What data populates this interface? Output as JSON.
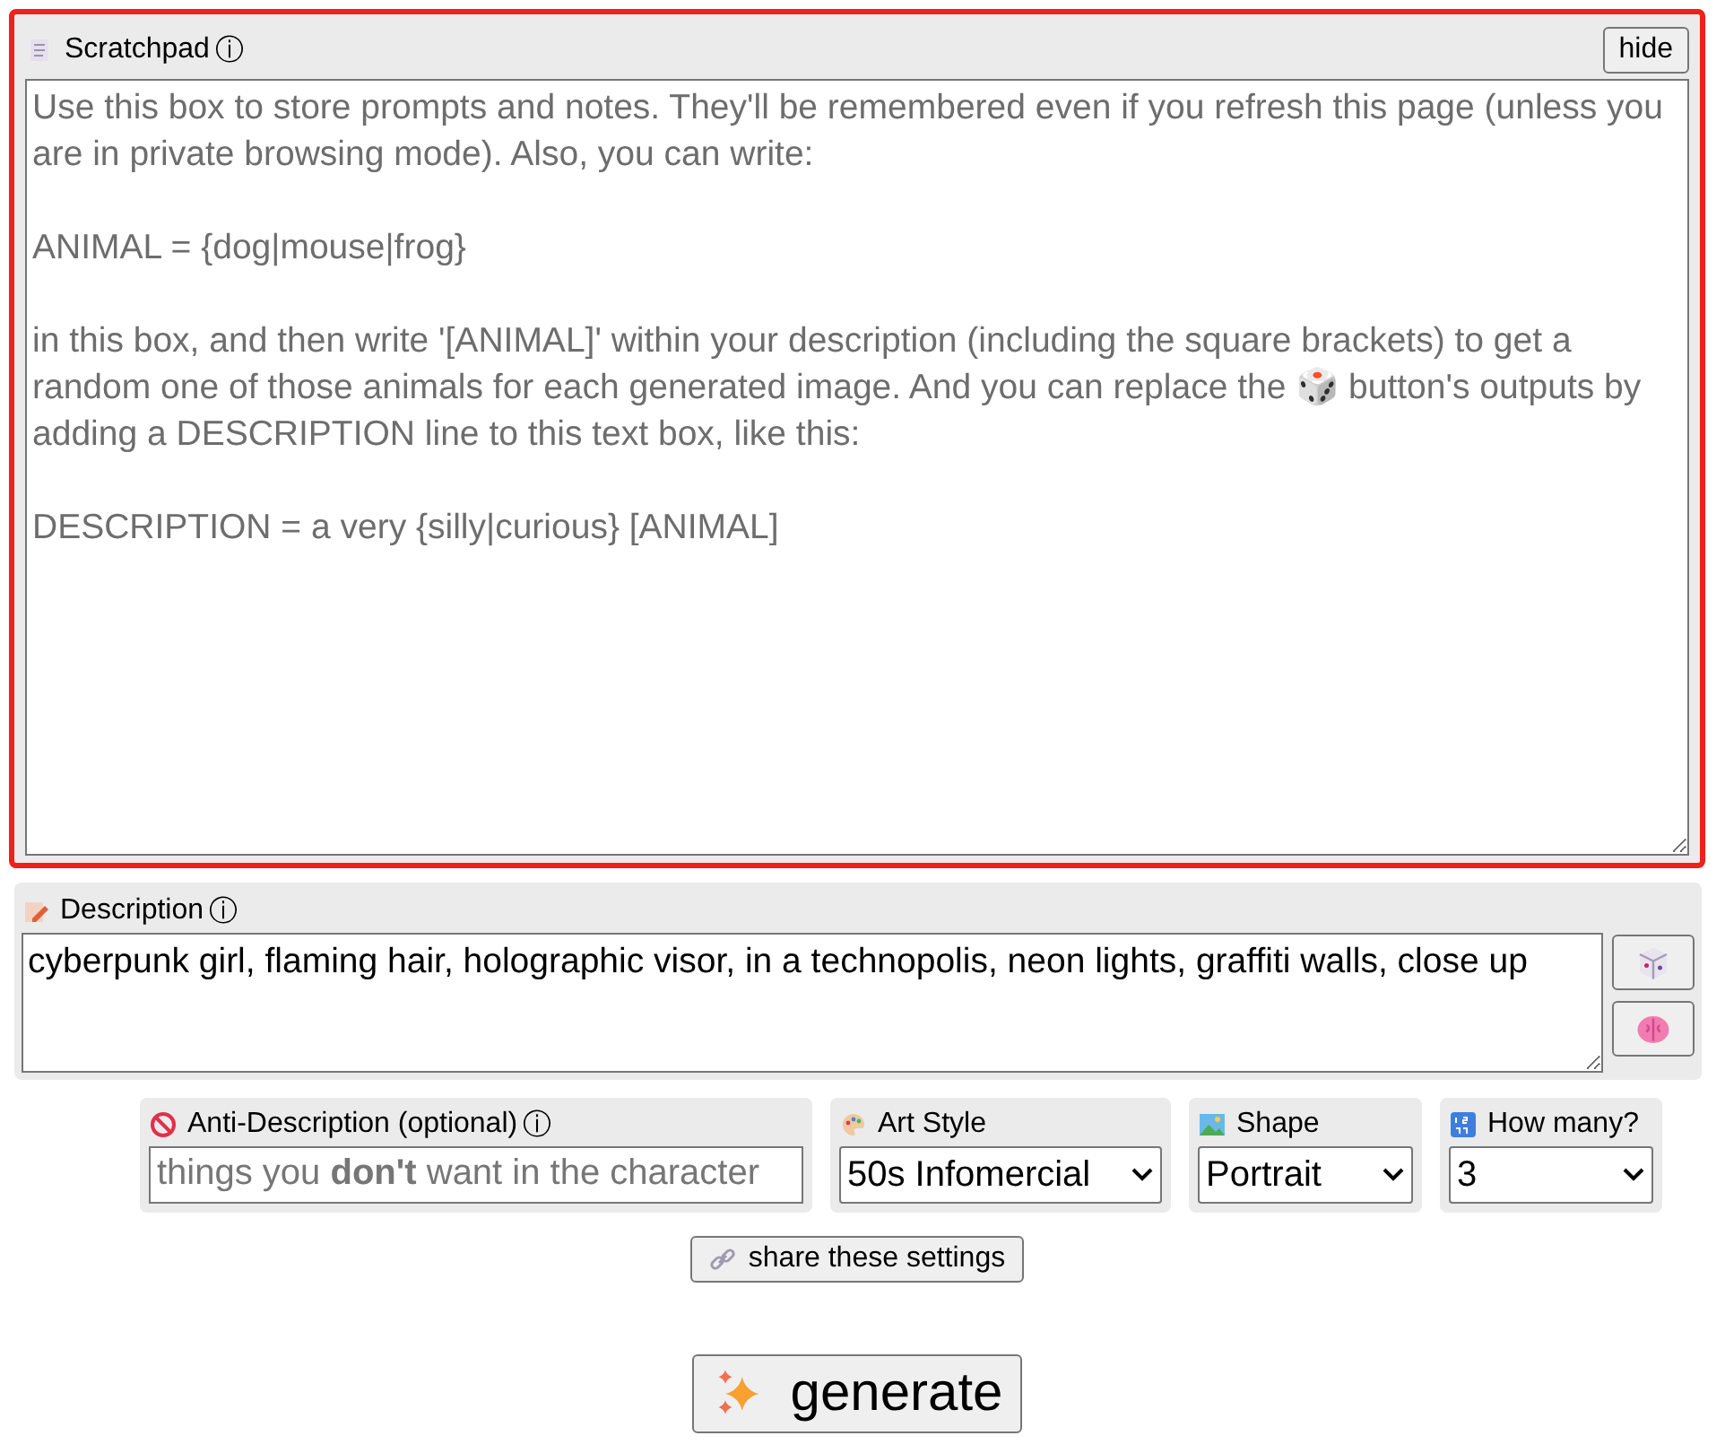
{
  "scratchpad": {
    "label": "Scratchpad",
    "info": "ⓘ",
    "hide_button": "hide",
    "highlighted": true,
    "value": "Use this box to store prompts and notes. They'll be remembered even if you refresh this page (unless you are in private browsing mode). Also, you can write:\n\nANIMAL = {dog|mouse|frog}\n\nin this box, and then write '[ANIMAL]' within your description (including the square brackets) to get a random one of those animals for each generated image. And you can replace the 🎲 button's outputs by adding a DESCRIPTION line to this text box, like this:\n\nDESCRIPTION = a very {silly|curious} [ANIMAL]"
  },
  "description": {
    "label": "Description",
    "info": "ⓘ",
    "value": "cyberpunk girl, flaming hair, holographic visor, in a technopolis, neon lights, graffiti walls, close up"
  },
  "options": [
    {
      "kind": "text",
      "label": "Anti-Description (optional)",
      "info": "ⓘ",
      "placeholder": "things you **don't** want in the character"
    },
    {
      "kind": "select",
      "label": "Art Style",
      "value": "50s Infomercial"
    },
    {
      "kind": "select",
      "label": "Shape",
      "value": "Portrait"
    },
    {
      "kind": "select",
      "label": "How many?",
      "value": "3"
    }
  ],
  "share_button": "share these settings",
  "generate_button": "generate"
}
